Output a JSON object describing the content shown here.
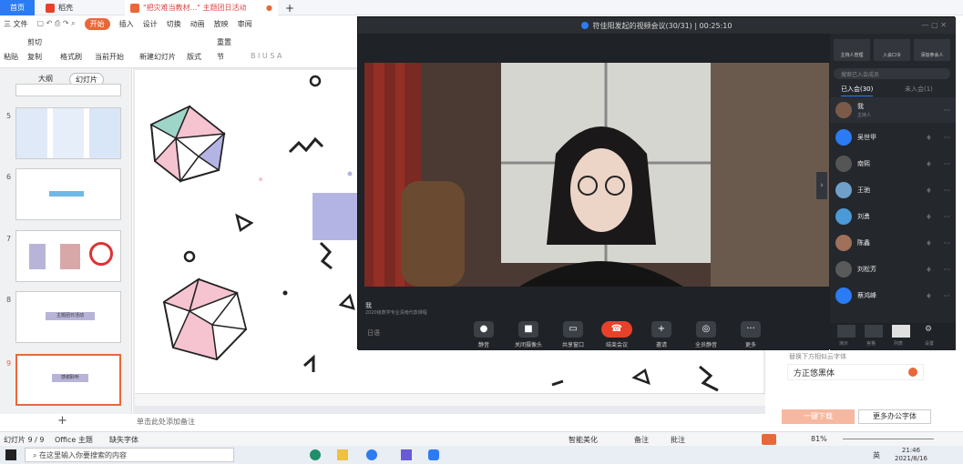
{
  "tabs": {
    "home": "首页",
    "wps": "稻壳",
    "doc": "\"把灾难当教材...\" 主题团日活动",
    "new": "+"
  },
  "menu": {
    "file": "三 文件",
    "start": "开始",
    "items": [
      "插入",
      "设计",
      "切换",
      "动画",
      "放映",
      "审阅"
    ]
  },
  "ribbon": {
    "cut": "剪切",
    "paste": "粘贴",
    "copy": "复制",
    "format_painter": "格式刷",
    "from_current": "当前开始",
    "new_slide": "新建幻灯片",
    "layout": "版式",
    "section": "节",
    "reset": "重置"
  },
  "left_panel": {
    "tab_outline": "大纲",
    "tab_slides": "幻灯片",
    "slide_numbers": [
      "5",
      "6",
      "7",
      "8",
      "9"
    ],
    "thumb8_label": "主题团日活动",
    "thumb9_label": "感谢聆听",
    "add": "+"
  },
  "notes_placeholder": "单击此处添加备注",
  "right_panel": {
    "hint": "替换下方相似云字体",
    "font_name": "方正悠黑体",
    "download": "一键下载",
    "more_fonts": "更多办公字体"
  },
  "status": {
    "slide_pos": "幻灯片 9 / 9",
    "theme": "Office 主题",
    "missing_font": "缺失字体",
    "smart": "智能美化",
    "notes": "备注",
    "comment": "批注",
    "zoom": "81%"
  },
  "taskbar": {
    "search": "在这里输入你要搜索的内容",
    "time": "21:46",
    "date": "2021/8/16",
    "lang": "英"
  },
  "meeting": {
    "title": "符佳阳发起的视频会议(30/31) | 00:25:10",
    "speaker": "我",
    "sub": "2020级数学专业清南代款课程",
    "top_buttons": [
      "主持人管理",
      "入会口令",
      "添加参会人"
    ],
    "search_placeholder": "搜索已入会成员",
    "tab_joined": "已入会(30)",
    "tab_not_joined": "未入会(1)",
    "participants": [
      {
        "name": "我",
        "role": "主持人",
        "color": "#7b5a4a"
      },
      {
        "name": "吴世甲",
        "role": "",
        "color": "#2b7bf5"
      },
      {
        "name": "南熙",
        "role": "",
        "color": "#555555"
      },
      {
        "name": "王驰",
        "role": "",
        "color": "#6fa0c8"
      },
      {
        "name": "刘勇",
        "role": "",
        "color": "#4a9ad8"
      },
      {
        "name": "陈鑫",
        "role": "",
        "color": "#a0705a"
      },
      {
        "name": "刘松芳",
        "role": "",
        "color": "#5a5a5a"
      },
      {
        "name": "蔡鸿峰",
        "role": "",
        "color": "#2b7bf5"
      }
    ],
    "controls": [
      "静音",
      "关闭摄像头",
      "共享窗口",
      "结束会议",
      "邀请",
      "全员静音",
      "更多"
    ],
    "layout_labels": [
      "演示",
      "宫格",
      "列表",
      "设置"
    ],
    "lang_btn": "日语"
  },
  "colors": {
    "accent": "#e8683a",
    "wps_blue": "#2b7bf5",
    "end_red": "#e8412b",
    "meeting_bg": "#1f2227"
  }
}
